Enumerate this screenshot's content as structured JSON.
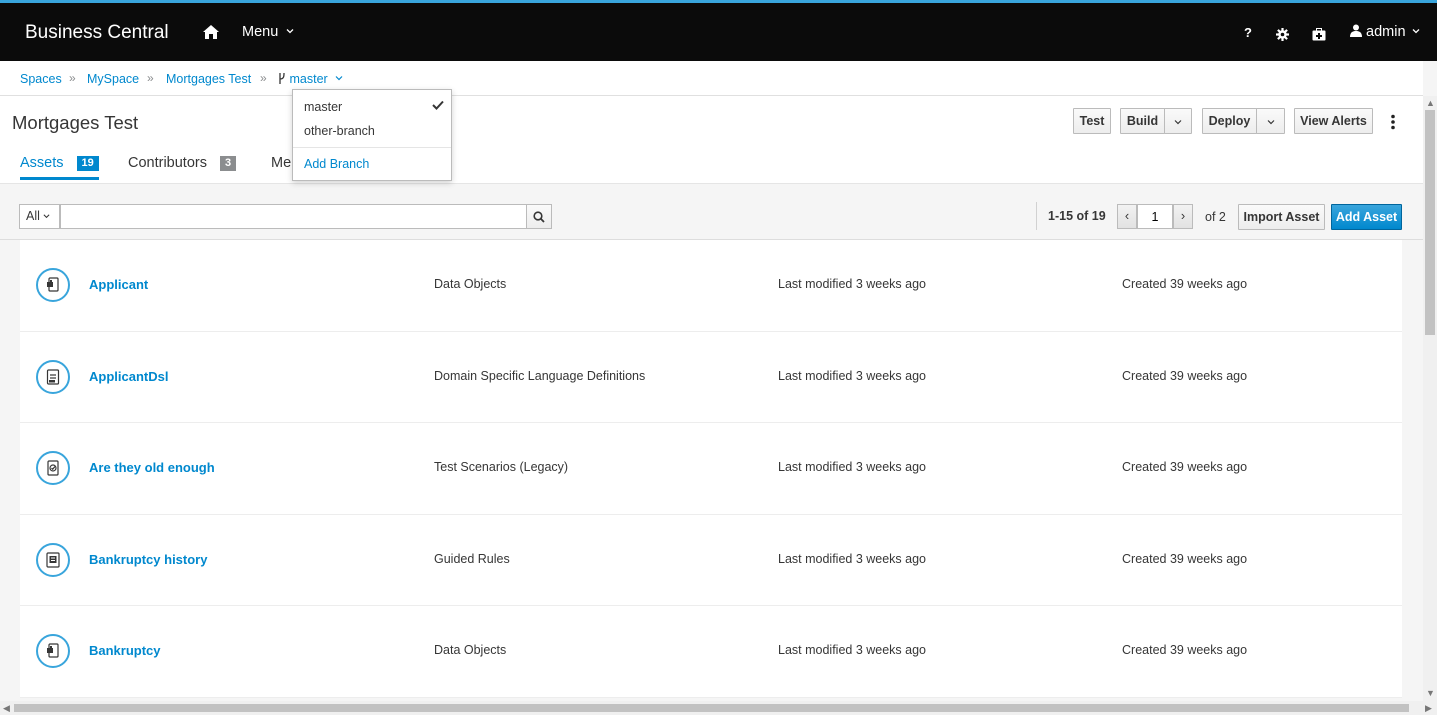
{
  "app": {
    "title": "Business Central",
    "menu_label": "Menu",
    "user_label": "admin"
  },
  "topbar_icons": [
    "help-icon",
    "gear-icon",
    "medkit-icon",
    "user-icon",
    "home-icon"
  ],
  "topbar": {
    "help_label": "?"
  },
  "breadcrumb": {
    "items": [
      "Spaces",
      "MySpace",
      "Mortgages Test"
    ],
    "separator": "»",
    "branch": "master"
  },
  "project": {
    "title": "Mortgages Test"
  },
  "actions": {
    "test": "Test",
    "build": "Build",
    "deploy": "Deploy",
    "view_alerts": "View Alerts"
  },
  "tabs": [
    {
      "label": "Assets",
      "count": "19",
      "active": true
    },
    {
      "label": "Contributors",
      "count": "3",
      "active": false
    },
    {
      "label": "Me",
      "active": false
    }
  ],
  "branch_dropdown": {
    "items": [
      "master",
      "other-branch"
    ],
    "selected": "master",
    "add_label": "Add Branch"
  },
  "toolbar": {
    "filter_value": "All",
    "search_value": "",
    "pagination_info": "1-15 of 19",
    "prev": "‹",
    "next": "›",
    "current_page": "1",
    "of_pages": "of 2",
    "import_label": "Import Asset",
    "add_label": "Add Asset"
  },
  "colors": {
    "accent": "#0088ce",
    "topbar": "#0b0b0b",
    "badge_assets": "#0088ce",
    "badge_contributors": "#8b8d8f"
  },
  "assets": [
    {
      "name": "Applicant",
      "type": "Data Objects",
      "modified": "Last modified 3 weeks ago",
      "created": "Created 39 weeks ago",
      "icon": "data-object-icon"
    },
    {
      "name": "ApplicantDsl",
      "type": "Domain Specific Language Definitions",
      "modified": "Last modified 3 weeks ago",
      "created": "Created 39 weeks ago",
      "icon": "dsl-icon"
    },
    {
      "name": "Are they old enough",
      "type": "Test Scenarios (Legacy)",
      "modified": "Last modified 3 weeks ago",
      "created": "Created 39 weeks ago",
      "icon": "test-scenario-icon"
    },
    {
      "name": "Bankruptcy history",
      "type": "Guided Rules",
      "modified": "Last modified 3 weeks ago",
      "created": "Created 39 weeks ago",
      "icon": "guided-rule-icon"
    },
    {
      "name": "Bankruptcy",
      "type": "Data Objects",
      "modified": "Last modified 3 weeks ago",
      "created": "Created 39 weeks ago",
      "icon": "data-object-icon"
    }
  ]
}
